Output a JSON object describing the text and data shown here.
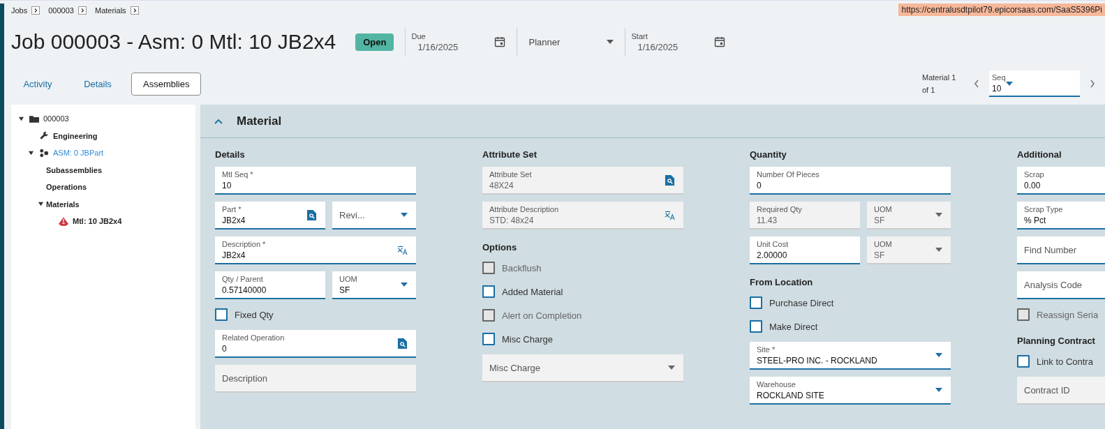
{
  "url_tooltip": "https://centralusdtpilot79.epicorsaas.com/SaaS5396Pi",
  "breadcrumbs": [
    "Jobs",
    "000003",
    "Materials"
  ],
  "title": "Job 000003 - Asm: 0 Mtl: 10 JB2x4",
  "status": "Open",
  "header_fields": [
    {
      "kind": "date",
      "label": "Due",
      "value": "1/16/2025"
    },
    {
      "kind": "select",
      "label": "Planner"
    },
    {
      "kind": "date",
      "label": "Start",
      "value": "1/16/2025"
    }
  ],
  "tabs": [
    {
      "label": "Activity",
      "selected": false
    },
    {
      "label": "Details",
      "selected": false
    },
    {
      "label": "Assemblies",
      "selected": true
    }
  ],
  "record_nav": {
    "position": "Material 1 of 1",
    "seq_label": "Seq",
    "seq_value": "10"
  },
  "tree": [
    {
      "label": "000003",
      "kind": "job",
      "expanded": true,
      "selected": false,
      "children": [
        {
          "label": "Engineering",
          "kind": "engineering",
          "selected": false
        },
        {
          "label": "ASM: 0 JBPart",
          "kind": "assembly",
          "expanded": true,
          "selected": true,
          "children": [
            {
              "label": "Subassemblies",
              "selected": false
            },
            {
              "label": "Operations",
              "selected": false
            },
            {
              "label": "Materials",
              "expanded": true,
              "selected": false,
              "children": [
                {
                  "label": "Mtl: 10 JB2x4",
                  "kind": "material",
                  "selected": false
                }
              ]
            }
          ]
        }
      ]
    }
  ],
  "panel": {
    "title": "Material",
    "expanded": true,
    "columns": [
      {
        "items": [
          {
            "kind": "heading",
            "text": "Details"
          },
          {
            "kind": "field",
            "field": {
              "kind": "text",
              "label": "Mtl Seq *",
              "value": "10",
              "disabled": false
            }
          },
          {
            "kind": "pair",
            "fields": [
              {
                "kind": "lookup",
                "label": "Part *",
                "value": "JB2x4",
                "disabled": false
              },
              {
                "kind": "select",
                "placeholder": "Revi...",
                "disabled": false
              }
            ]
          },
          {
            "kind": "field",
            "field": {
              "kind": "translate",
              "label": "Description *",
              "value": "JB2x4",
              "disabled": false
            }
          },
          {
            "kind": "pair",
            "fields": [
              {
                "kind": "text",
                "label": "Qty / Parent",
                "value": "0.57140000",
                "disabled": false
              },
              {
                "kind": "select",
                "label": "UOM",
                "value": "SF",
                "disabled": false
              }
            ]
          },
          {
            "kind": "checkbox",
            "label": "Fixed Qty",
            "checked": false,
            "disabled": false
          },
          {
            "kind": "field",
            "field": {
              "kind": "lookup",
              "label": "Related Operation",
              "value": "0",
              "disabled": false
            }
          },
          {
            "kind": "field",
            "field": {
              "kind": "text",
              "placeholder": "Description",
              "disabled": true
            }
          }
        ]
      },
      {
        "items": [
          {
            "kind": "heading",
            "text": "Attribute Set"
          },
          {
            "kind": "field",
            "field": {
              "kind": "lookup",
              "label": "Attribute Set",
              "value": "48X24",
              "disabled": true
            }
          },
          {
            "kind": "field",
            "field": {
              "kind": "translate",
              "label": "Attribute Description",
              "value": "STD: 48x24",
              "disabled": true
            }
          },
          {
            "kind": "heading",
            "text": "Options"
          },
          {
            "kind": "checkbox",
            "label": "Backflush",
            "checked": false,
            "disabled": true
          },
          {
            "kind": "checkbox",
            "label": "Added Material",
            "checked": false,
            "disabled": false
          },
          {
            "kind": "checkbox",
            "label": "Alert on Completion",
            "checked": false,
            "disabled": true
          },
          {
            "kind": "checkbox",
            "label": "Misc Charge",
            "checked": false,
            "disabled": false
          },
          {
            "kind": "field",
            "field": {
              "kind": "select",
              "placeholder": "Misc Charge",
              "disabled": true
            }
          }
        ]
      },
      {
        "items": [
          {
            "kind": "heading",
            "text": "Quantity"
          },
          {
            "kind": "field",
            "field": {
              "kind": "text",
              "label": "Number Of Pieces",
              "value": "0",
              "disabled": false
            }
          },
          {
            "kind": "pair",
            "fields": [
              {
                "kind": "text",
                "label": "Required Qty",
                "value": "11.43",
                "disabled": true
              },
              {
                "kind": "select",
                "label": "UOM",
                "value": "SF",
                "disabled": true
              }
            ]
          },
          {
            "kind": "pair",
            "fields": [
              {
                "kind": "text",
                "label": "Unit Cost",
                "value": "2.00000",
                "disabled": false
              },
              {
                "kind": "select",
                "label": "UOM",
                "value": "SF",
                "disabled": true
              }
            ]
          },
          {
            "kind": "heading",
            "text": "From Location"
          },
          {
            "kind": "checkbox",
            "label": "Purchase Direct",
            "checked": false,
            "disabled": false
          },
          {
            "kind": "checkbox",
            "label": "Make Direct",
            "checked": false,
            "disabled": false
          },
          {
            "kind": "field",
            "field": {
              "kind": "select",
              "label": "Site *",
              "value": "STEEL-PRO INC. - ROCKLAND",
              "disabled": false
            }
          },
          {
            "kind": "field",
            "field": {
              "kind": "select",
              "label": "Warehouse",
              "value": "ROCKLAND SITE",
              "disabled": false
            }
          }
        ]
      },
      {
        "items": [
          {
            "kind": "heading",
            "text": "Additional"
          },
          {
            "kind": "field",
            "field": {
              "kind": "text",
              "label": "Scrap",
              "value": "0.00",
              "disabled": false
            }
          },
          {
            "kind": "field",
            "field": {
              "kind": "text",
              "label": "Scrap Type",
              "value": "% Pct",
              "disabled": false
            }
          },
          {
            "kind": "field",
            "field": {
              "kind": "text",
              "placeholder": "Find Number",
              "disabled": false
            }
          },
          {
            "kind": "field",
            "field": {
              "kind": "text",
              "placeholder": "Analysis Code",
              "disabled": false
            }
          },
          {
            "kind": "checkbox",
            "label": "Reassign Seria",
            "checked": false,
            "disabled": true
          },
          {
            "kind": "heading",
            "text": "Planning Contract"
          },
          {
            "kind": "checkbox",
            "label": "Link to Contra",
            "checked": false,
            "disabled": false
          },
          {
            "kind": "field",
            "field": {
              "kind": "text",
              "placeholder": "Contract ID",
              "disabled": true
            }
          }
        ]
      }
    ]
  }
}
